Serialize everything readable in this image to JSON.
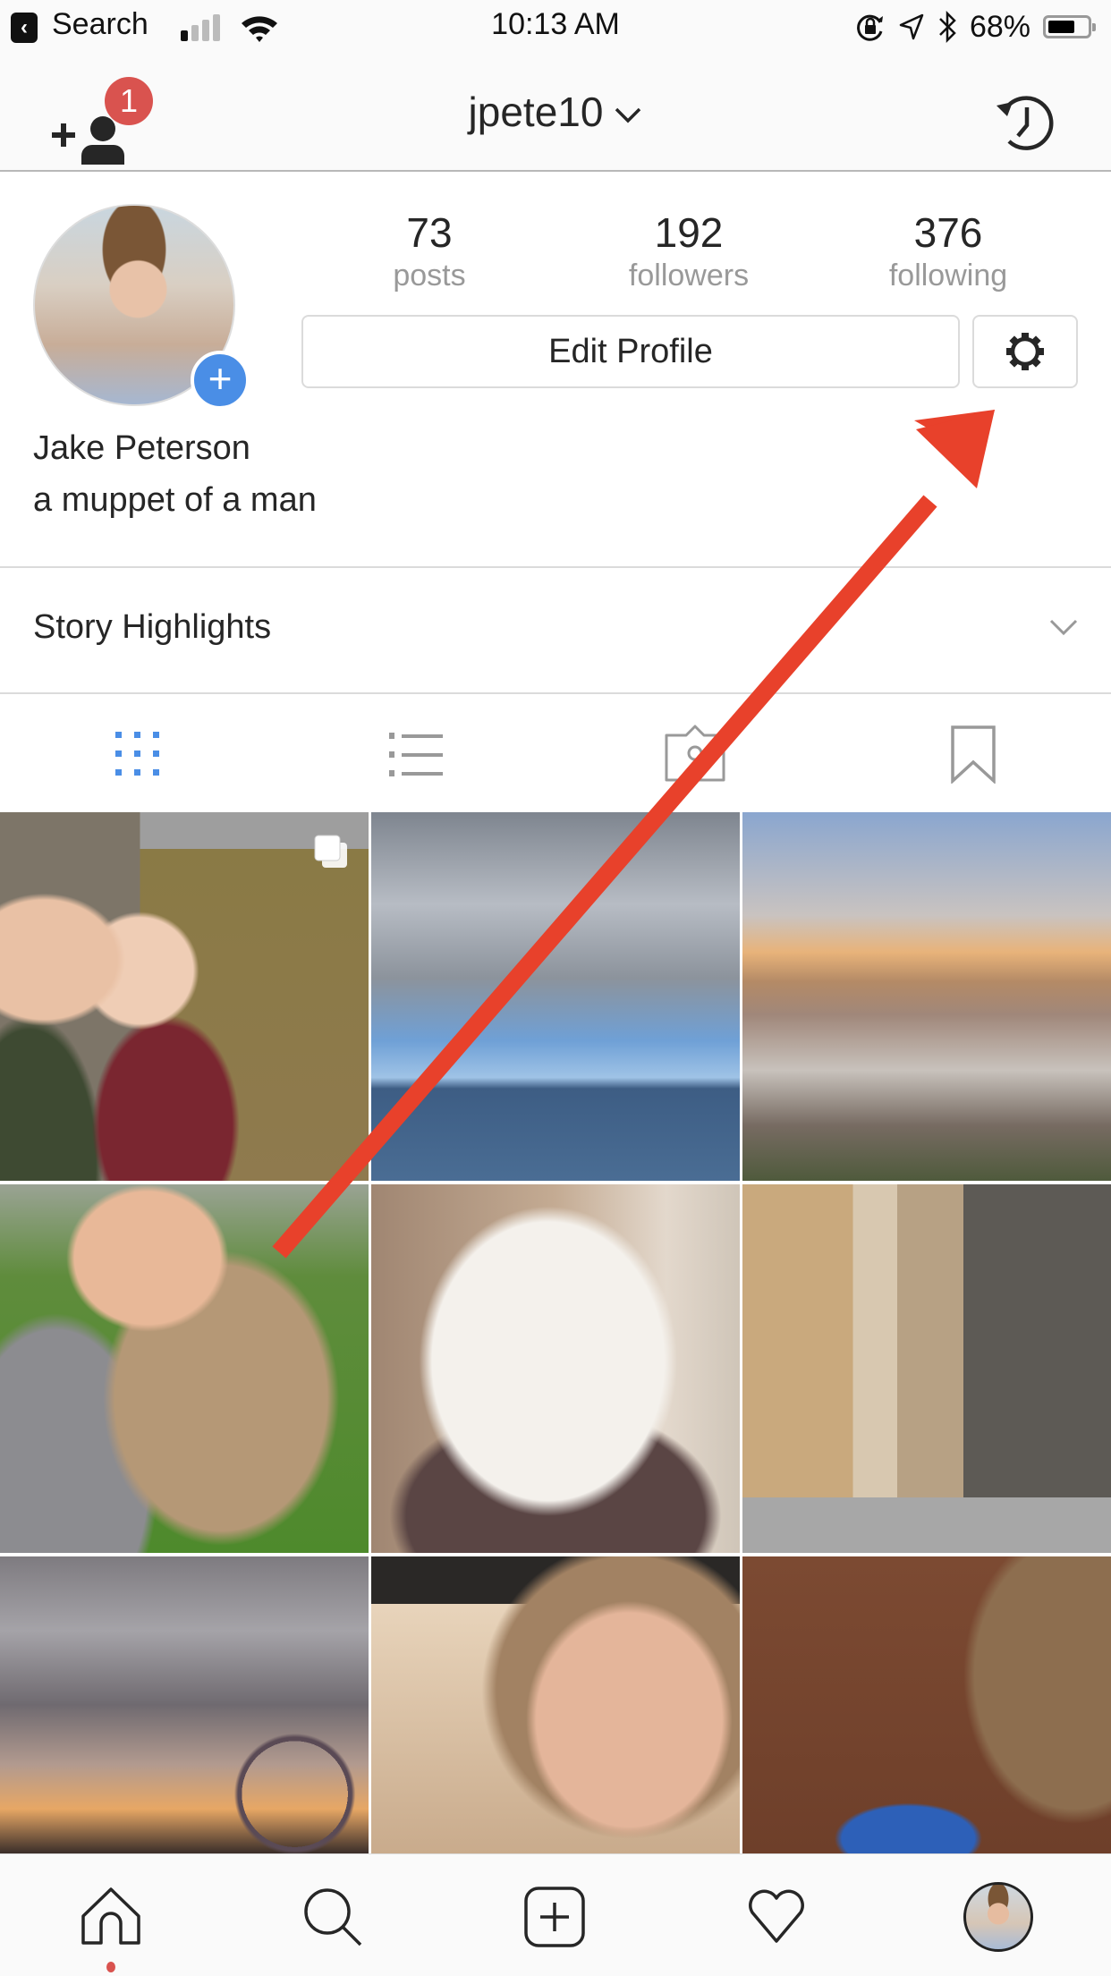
{
  "status_bar": {
    "back_label": "Search",
    "time": "10:13 AM",
    "battery_percent_label": "68%",
    "battery_level": 0.68,
    "signal_bars_filled": 1,
    "signal_bars_total": 4,
    "icons": [
      "back-arrow-icon",
      "signal-icon",
      "wifi-icon",
      "rotation-lock-icon",
      "location-icon",
      "bluetooth-icon",
      "battery-icon"
    ]
  },
  "nav": {
    "username": "jpete10",
    "notification_count": "1",
    "left_icon": "add-user-icon",
    "right_icon": "archive-history-icon"
  },
  "profile": {
    "stats": [
      {
        "value": "73",
        "label": "posts"
      },
      {
        "value": "192",
        "label": "followers"
      },
      {
        "value": "376",
        "label": "following"
      }
    ],
    "edit_button_label": "Edit Profile",
    "settings_icon": "gear-icon",
    "full_name": "Jake Peterson",
    "bio": "a muppet of a man"
  },
  "story_highlights": {
    "label": "Story Highlights"
  },
  "content_tabs": [
    {
      "name": "grid",
      "icon": "grid-icon",
      "active": true
    },
    {
      "name": "list",
      "icon": "list-icon",
      "active": false
    },
    {
      "name": "tagged",
      "icon": "tagged-photos-icon",
      "active": false
    },
    {
      "name": "saved",
      "icon": "bookmark-icon",
      "active": false
    }
  ],
  "posts": [
    {
      "description": "selfie couple with coffee under tree",
      "multi": true
    },
    {
      "description": "marina with cloudy sky",
      "multi": false
    },
    {
      "description": "city skyline at sunset",
      "multi": false
    },
    {
      "description": "girl hugging fluffy dog on lawn",
      "multi": false
    },
    {
      "description": "white bichon dog on couch",
      "multi": false
    },
    {
      "description": "city street with tall buildings",
      "multi": false
    },
    {
      "description": "ferris wheel under cloudy sky",
      "multi": false
    },
    {
      "description": "mural of girl's face",
      "multi": false
    },
    {
      "description": "brownstone with blue beetle car",
      "multi": false
    }
  ],
  "bottom_tabs": [
    {
      "name": "home",
      "icon": "home-icon"
    },
    {
      "name": "search",
      "icon": "search-icon"
    },
    {
      "name": "new-post",
      "icon": "add-post-icon"
    },
    {
      "name": "activity",
      "icon": "heart-icon"
    },
    {
      "name": "profile",
      "icon": "profile-avatar-icon"
    }
  ],
  "colors": {
    "accent_blue": "#4a8ee6",
    "badge_red": "#d9534f",
    "annotation_red": "#e8412b",
    "text_primary": "#262626",
    "text_secondary": "#999999"
  },
  "annotation": {
    "type": "arrow",
    "points_to": "settings-gear-button"
  }
}
